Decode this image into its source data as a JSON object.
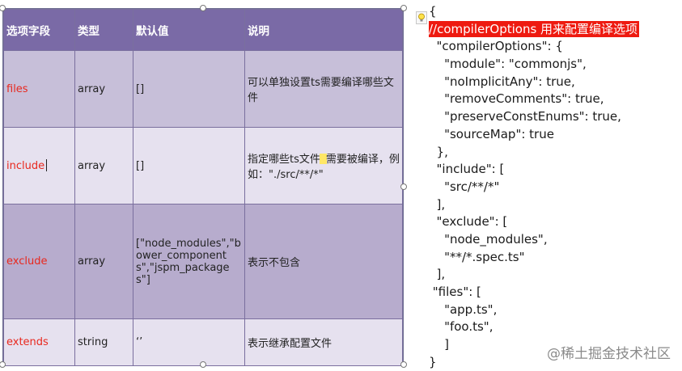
{
  "table": {
    "headers": [
      "选项字段",
      "类型",
      "默认值",
      "说明"
    ],
    "rows": [
      {
        "field": "files",
        "type": "array",
        "default": "[]",
        "desc": "可以单独设置ts需要编译哪些文件"
      },
      {
        "field": "include",
        "type": "array",
        "default": "[]",
        "desc_a": "指定哪些ts文件",
        "desc_b": "需要被编译，例如：\"./src/**/*\""
      },
      {
        "field": "exclude",
        "type": "array",
        "default": "[\"node_modules\",\"bower_components\",\"jspm_packages\"]",
        "desc": "表示不包含"
      },
      {
        "field": "extends",
        "type": "string",
        "default": "‘’",
        "desc": "表示继承配置文件"
      }
    ]
  },
  "code": {
    "lines": [
      "{",
      "//compilerOptions 用来配置编译选项",
      "  \"compilerOptions\": {",
      "    \"module\": \"commonjs\",",
      "    \"noImplicitAny\": true,",
      "    \"removeComments\": true,",
      "    \"preserveConstEnums\": true,",
      "    \"sourceMap\": true",
      "  },",
      "  \"include\": [",
      "    \"src/**/*\"",
      "  ],",
      "  \"exclude\": [",
      "    \"node_modules\",",
      "    \"**/*.spec.ts\"",
      "  ],",
      " \"files\": [",
      "    \"app.ts\",",
      "    \"foo.ts\",",
      "    ]",
      "}"
    ]
  },
  "watermark": "@稀土掘金技术社区",
  "colors": {
    "header_bg": "#7a6aa6",
    "row_dark": "#c7bfd9",
    "row_light": "#e6e1ef",
    "field_red": "#e8281e",
    "comment_highlight": "#ee1a10"
  },
  "icons": {
    "lightbulb": "lightbulb-icon"
  }
}
